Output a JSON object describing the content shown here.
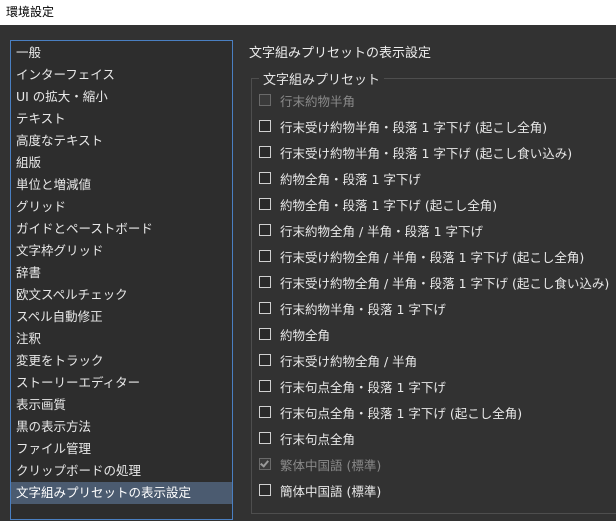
{
  "window": {
    "title": "環境設定"
  },
  "sidebar": {
    "items": [
      {
        "label": "一般"
      },
      {
        "label": "インターフェイス"
      },
      {
        "label": "UI の拡大・縮小"
      },
      {
        "label": "テキスト"
      },
      {
        "label": "高度なテキスト"
      },
      {
        "label": "組版"
      },
      {
        "label": "単位と増減値"
      },
      {
        "label": "グリッド"
      },
      {
        "label": "ガイドとペーストボード"
      },
      {
        "label": "文字枠グリッド"
      },
      {
        "label": "辞書"
      },
      {
        "label": "欧文スペルチェック"
      },
      {
        "label": "スペル自動修正"
      },
      {
        "label": "注釈"
      },
      {
        "label": "変更をトラック"
      },
      {
        "label": "ストーリーエディター"
      },
      {
        "label": "表示画質"
      },
      {
        "label": "黒の表示方法"
      },
      {
        "label": "ファイル管理"
      },
      {
        "label": "クリップボードの処理"
      },
      {
        "label": "文字組みプリセットの表示設定",
        "selected": true
      }
    ]
  },
  "panel": {
    "title": "文字組みプリセットの表示設定",
    "group_label": "文字組みプリセット",
    "options": [
      {
        "label": "行末約物半角",
        "checked": false,
        "disabled": true
      },
      {
        "label": "行末受け約物半角・段落 1 字下げ (起こし全角)",
        "checked": false,
        "disabled": false
      },
      {
        "label": "行末受け約物半角・段落 1 字下げ (起こし食い込み)",
        "checked": false,
        "disabled": false
      },
      {
        "label": "約物全角・段落 1 字下げ",
        "checked": false,
        "disabled": false
      },
      {
        "label": "約物全角・段落 1 字下げ (起こし全角)",
        "checked": false,
        "disabled": false
      },
      {
        "label": "行末約物全角 / 半角・段落 1 字下げ",
        "checked": false,
        "disabled": false
      },
      {
        "label": "行末受け約物全角 / 半角・段落 1 字下げ (起こし全角)",
        "checked": false,
        "disabled": false
      },
      {
        "label": "行末受け約物全角 / 半角・段落 1 字下げ (起こし食い込み)",
        "checked": false,
        "disabled": false
      },
      {
        "label": "行末約物半角・段落 1 字下げ",
        "checked": false,
        "disabled": false
      },
      {
        "label": "約物全角",
        "checked": false,
        "disabled": false
      },
      {
        "label": "行末受け約物全角 / 半角",
        "checked": false,
        "disabled": false
      },
      {
        "label": "行末句点全角・段落 1 字下げ",
        "checked": false,
        "disabled": false
      },
      {
        "label": "行末句点全角・段落 1 字下げ (起こし全角)",
        "checked": false,
        "disabled": false
      },
      {
        "label": "行末句点全角",
        "checked": false,
        "disabled": false
      },
      {
        "label": "繁体中国語 (標準)",
        "checked": true,
        "disabled": true
      },
      {
        "label": "簡体中国語 (標準)",
        "checked": false,
        "disabled": false
      }
    ]
  }
}
